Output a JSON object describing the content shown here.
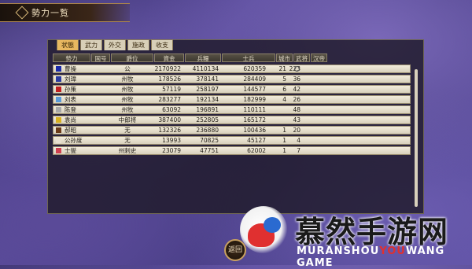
{
  "window": {
    "title": "勢力一覧"
  },
  "tabs": [
    "状態",
    "武力",
    "外交",
    "施政",
    "收支"
  ],
  "active_tab": 0,
  "columns": [
    "勢力",
    "国号",
    "爵位",
    "資金",
    "兵糧",
    "士兵",
    "城市",
    "武将",
    "汉帝"
  ],
  "rows": [
    {
      "name": "曹操",
      "color": "#1a2aa8",
      "title": "公",
      "gold": "2170922",
      "food": "4110134",
      "soldiers": "620359",
      "cities": "21",
      "generals": "223",
      "emperor": "○"
    },
    {
      "name": "刘璋",
      "color": "#2a3aa0",
      "title": "州牧",
      "gold": "178526",
      "food": "378141",
      "soldiers": "284409",
      "cities": "5",
      "generals": "36",
      "emperor": ""
    },
    {
      "name": "孙策",
      "color": "#c02020",
      "title": "州牧",
      "gold": "57119",
      "food": "258197",
      "soldiers": "144577",
      "cities": "6",
      "generals": "42",
      "emperor": ""
    },
    {
      "name": "刘表",
      "color": "#5a9ad8",
      "title": "州牧",
      "gold": "283277",
      "food": "192134",
      "soldiers": "182999",
      "cities": "4",
      "generals": "26",
      "emperor": ""
    },
    {
      "name": "陈登",
      "color": "#a8a8a8",
      "title": "州牧",
      "gold": "63092",
      "food": "196891",
      "soldiers": "110111",
      "cities": "",
      "generals": "48",
      "emperor": ""
    },
    {
      "name": "袁尚",
      "color": "#d8b020",
      "title": "中郎将",
      "gold": "387400",
      "food": "252805",
      "soldiers": "165172",
      "cities": "",
      "generals": "43",
      "emperor": ""
    },
    {
      "name": "郝昭",
      "color": "#6a3a18",
      "title": "无",
      "gold": "132326",
      "food": "236880",
      "soldiers": "100436",
      "cities": "1",
      "generals": "20",
      "emperor": ""
    },
    {
      "name": "公孙度",
      "color": "#e8e0d0",
      "title": "无",
      "gold": "13993",
      "food": "70825",
      "soldiers": "45127",
      "cities": "1",
      "generals": "4",
      "emperor": ""
    },
    {
      "name": "士燮",
      "color": "#d04050",
      "title": "州刺史",
      "gold": "23079",
      "food": "47751",
      "soldiers": "62002",
      "cities": "1",
      "generals": "7",
      "emperor": ""
    }
  ],
  "back_button": "返回",
  "watermark": {
    "text": "慕然手游网",
    "sub_pre": "MURANSHOU",
    "sub_hl": "YOU",
    "sub_post": "WANG",
    "sub_game": "GAME"
  }
}
